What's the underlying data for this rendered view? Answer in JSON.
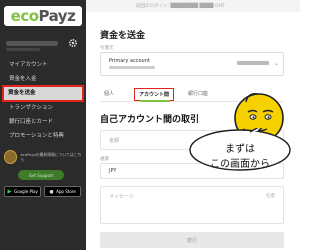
{
  "brand": {
    "logo_eco": "eco",
    "logo_payz": "Payz"
  },
  "topbar": {
    "text": "前回のログイン: ████████ ████ GMT"
  },
  "sidebar": {
    "items": [
      {
        "label": "マイアカウント",
        "active": false
      },
      {
        "label": "資金を入金",
        "active": false
      },
      {
        "label": "資金を送金",
        "active": true
      },
      {
        "label": "トランザクション",
        "active": false
      },
      {
        "label": "銀行口座とカード",
        "active": false
      },
      {
        "label": "プロモーションと特典",
        "active": false
      }
    ],
    "badge_text": "ecoPayzの最新情報についてはこちら",
    "green_pill": "Get Support",
    "store_google": "Google Play",
    "store_apple": "App Store"
  },
  "main": {
    "page_title": "資金を送金",
    "from_label": "引落元",
    "from_account_title": "Primary account",
    "tabs": [
      {
        "label": "個人",
        "active": false
      },
      {
        "label": "アカウント間",
        "active": true
      },
      {
        "label": "銀行口座",
        "active": false
      }
    ],
    "section_title": "自己アカウント間の取引",
    "amount_placeholder": "金額",
    "currency_label": "通貨",
    "currency_value": "JPY",
    "message_placeholder": "メッセージ",
    "message_optional": "任意",
    "confirm_label": "続行"
  },
  "overlay": {
    "bubble_line1": "まずは",
    "bubble_line2": "この画面から"
  },
  "colors": {
    "sidebar_bg": "#2b2b2b",
    "accent_green": "#7fc241",
    "highlight_red": "#e2241b",
    "mascot_yellow": "#f5d100"
  }
}
